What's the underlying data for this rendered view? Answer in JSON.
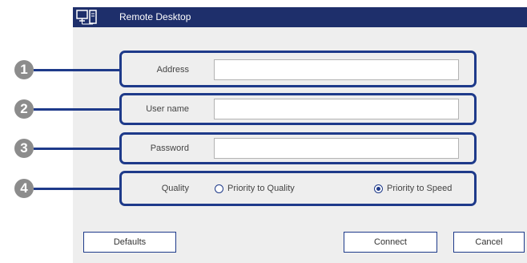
{
  "window": {
    "title": "Remote Desktop"
  },
  "callouts": [
    "1",
    "2",
    "3",
    "4"
  ],
  "form": {
    "address": {
      "label": "Address",
      "value": ""
    },
    "username": {
      "label": "User name",
      "value": ""
    },
    "password": {
      "label": "Password",
      "value": ""
    },
    "quality": {
      "label": "Quality",
      "options": [
        {
          "label": "Priority to Quality",
          "selected": false
        },
        {
          "label": "Priority to Speed",
          "selected": true
        }
      ]
    }
  },
  "buttons": {
    "defaults": "Defaults",
    "connect": "Connect",
    "cancel": "Cancel"
  },
  "colors": {
    "titlebar": "#1e2f6b",
    "accent": "#1e3a8a",
    "callout": "#8c8c8c",
    "panel": "#eeeeee"
  }
}
